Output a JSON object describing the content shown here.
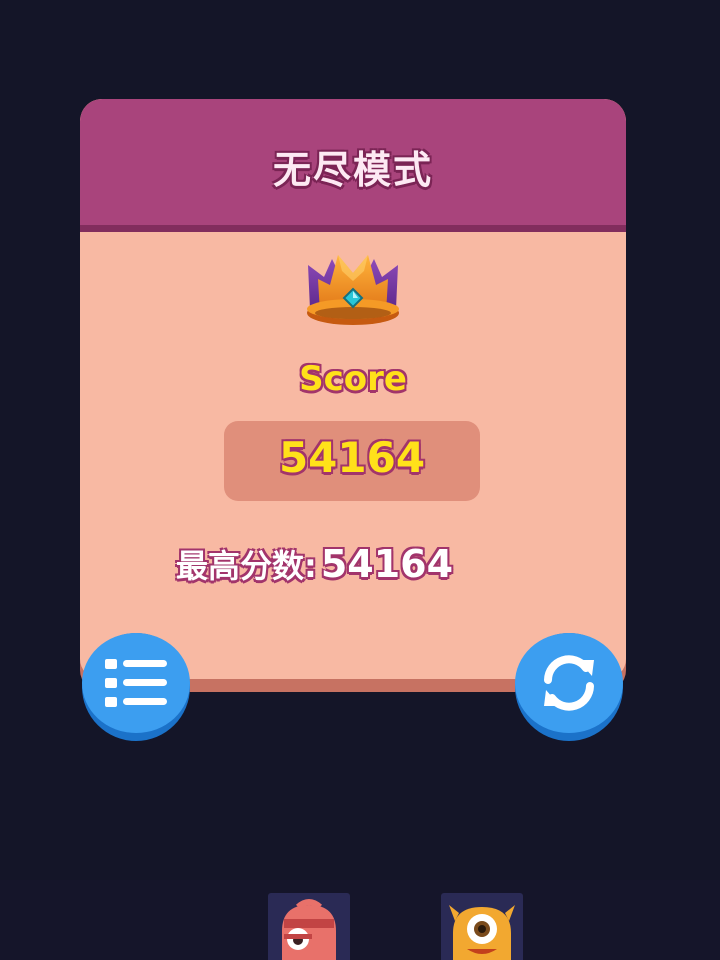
{
  "panel": {
    "title": "无尽模式",
    "score_label": "Score",
    "score_value": "54164",
    "best_label": "最高分数:",
    "best_value": "54164"
  },
  "buttons": {
    "menu_icon": "list-menu-icon",
    "restart_icon": "refresh-icon"
  },
  "colors": {
    "background": "#141528",
    "panel_header": "#a9447c",
    "panel_body": "#f8b9a3",
    "score_text": "#ffe11a",
    "button_blue": "#3c9ef0"
  },
  "characters": [
    "red-one-eyed-monster",
    "yellow-one-eyed-monster"
  ]
}
